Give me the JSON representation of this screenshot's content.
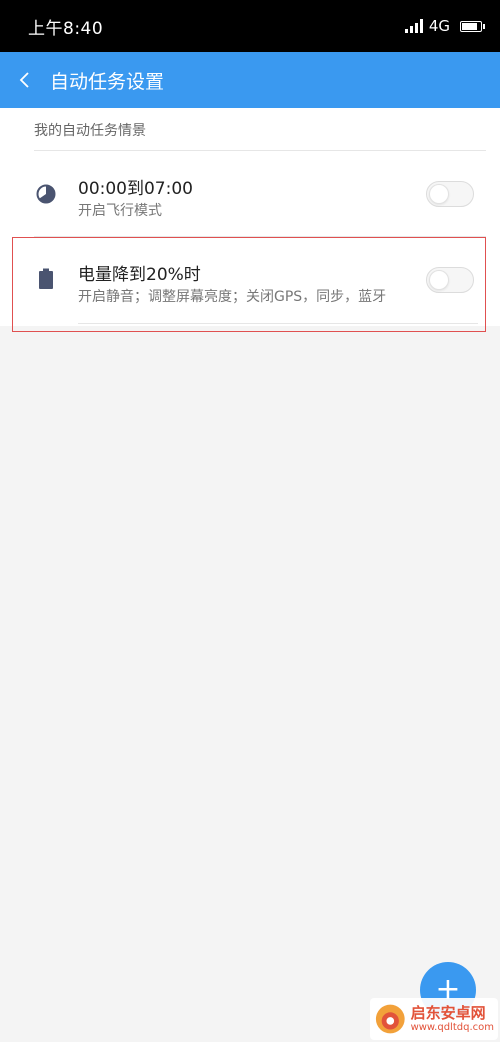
{
  "status_bar": {
    "time": "上午8:40",
    "network": "4G"
  },
  "app_bar": {
    "title": "自动任务设置"
  },
  "section": {
    "header": "我的自动任务情景"
  },
  "tasks": [
    {
      "title": "00:00到07:00",
      "subtitle": "开启飞行模式",
      "enabled": false,
      "icon": "clock-icon"
    },
    {
      "title": "电量降到20%时",
      "subtitle": "开启静音；调整屏幕亮度；关闭GPS，同步，蓝牙",
      "enabled": false,
      "icon": "battery-icon"
    }
  ],
  "fab": {
    "label": "+"
  },
  "watermark": {
    "title": "启东安卓网",
    "url": "www.qdltdq.com"
  },
  "colors": {
    "accent": "#3a99f0",
    "highlight": "#e05050",
    "status_bar": "#000000"
  }
}
